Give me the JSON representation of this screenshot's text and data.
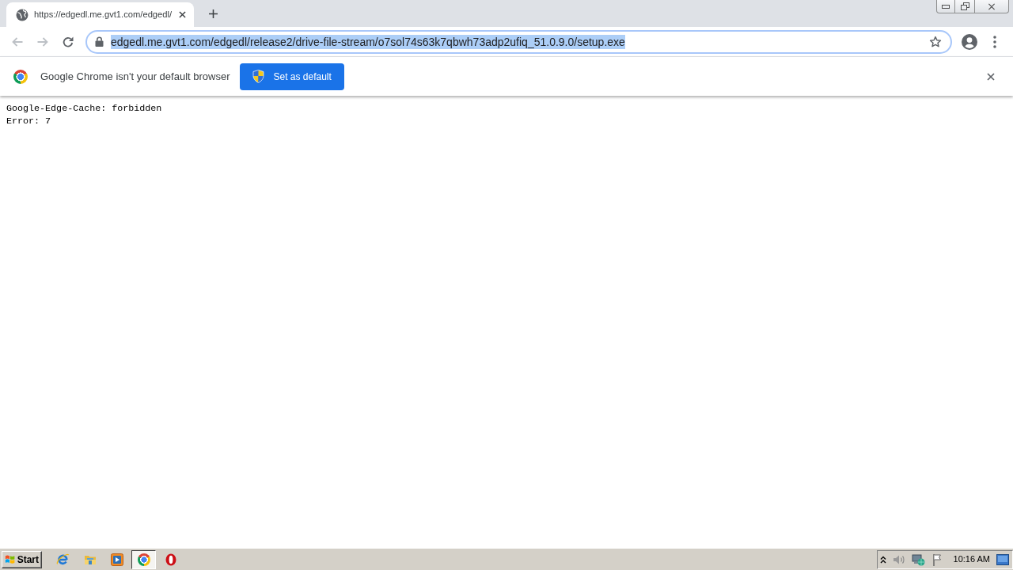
{
  "tabs": [
    {
      "title": "https://edgedl.me.gvt1.com/edgedl/",
      "selected": true
    }
  ],
  "toolbar": {
    "back": {
      "disabled": true
    },
    "forward": {
      "disabled": true
    },
    "address": {
      "url": "edgedl.me.gvt1.com/edgedl/release2/drive-file-stream/o7sol74s63k7qbwh73adp2ufiq_51.0.9.0/setup.exe",
      "selected": true
    }
  },
  "infobar": {
    "message": "Google Chrome isn't your default browser",
    "button": "Set as default"
  },
  "page": {
    "lines": [
      "Google-Edge-Cache: forbidden",
      "Error: 7"
    ]
  },
  "taskbar": {
    "start": "Start",
    "apps": [
      {
        "kind": "ie",
        "selected": false
      },
      {
        "kind": "explorer",
        "selected": false
      },
      {
        "kind": "media",
        "selected": false
      },
      {
        "kind": "chrome",
        "selected": true
      },
      {
        "kind": "opera",
        "selected": false
      }
    ],
    "clock": "10:16 AM"
  }
}
